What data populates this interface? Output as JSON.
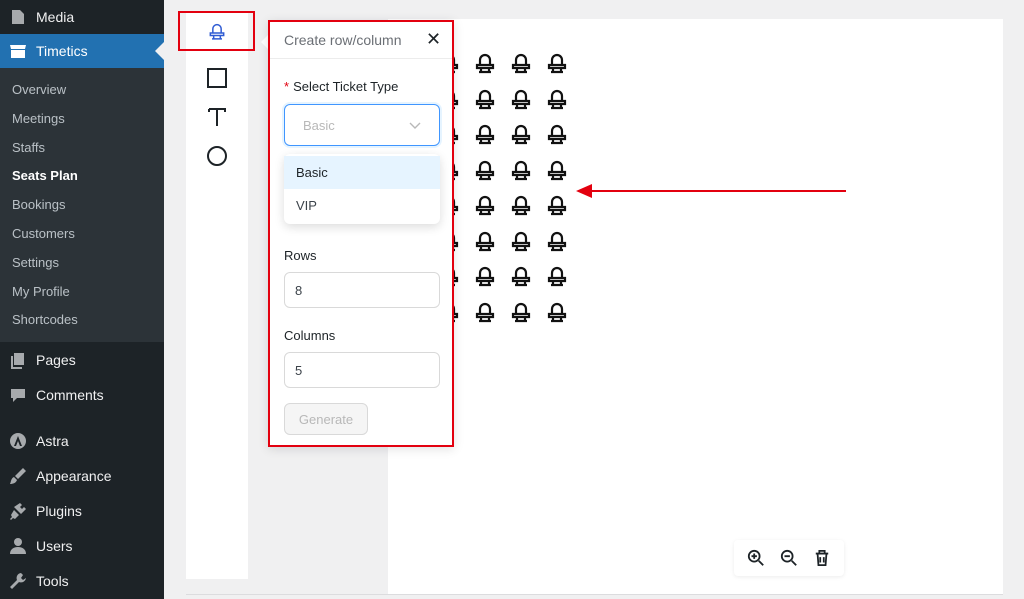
{
  "sidebar": {
    "items": [
      {
        "label": "Media",
        "icon": "media-icon"
      },
      {
        "label": "Timetics",
        "icon": "store-icon",
        "active": true
      },
      {
        "label": "Pages",
        "icon": "pages-icon"
      },
      {
        "label": "Comments",
        "icon": "comments-icon"
      },
      {
        "label": "Astra",
        "icon": "astra-icon"
      },
      {
        "label": "Appearance",
        "icon": "brush-icon"
      },
      {
        "label": "Plugins",
        "icon": "plugins-icon"
      },
      {
        "label": "Users",
        "icon": "users-icon"
      },
      {
        "label": "Tools",
        "icon": "wrench-icon"
      }
    ],
    "submenu": [
      {
        "label": "Overview"
      },
      {
        "label": "Meetings"
      },
      {
        "label": "Staffs"
      },
      {
        "label": "Seats Plan",
        "current": true
      },
      {
        "label": "Bookings"
      },
      {
        "label": "Customers"
      },
      {
        "label": "Settings"
      },
      {
        "label": "My Profile"
      },
      {
        "label": "Shortcodes"
      }
    ]
  },
  "tools": [
    "seat-tool-icon",
    "rectangle-tool-icon",
    "text-tool-icon",
    "circle-tool-icon"
  ],
  "panel": {
    "title": "Create row/column",
    "close": "✕",
    "ticket_label": "Select Ticket Type",
    "required_mark": "*",
    "ticket_selected": "Basic",
    "ticket_options": [
      "Basic",
      "VIP"
    ],
    "rows_label": "Rows",
    "rows_value": "8",
    "columns_label": "Columns",
    "columns_value": "5",
    "generate_label": "Generate"
  },
  "seat_grid": {
    "rows": 8,
    "visible_columns": 4
  },
  "zoombar": [
    "zoom-in-icon",
    "zoom-out-icon",
    "trash-icon"
  ],
  "colors": {
    "sidebar_bg": "#1d2327",
    "submenu_bg": "#2c3338",
    "active_bg": "#2271b1",
    "highlight": "#e3000f",
    "select_focus": "#4096ff"
  }
}
